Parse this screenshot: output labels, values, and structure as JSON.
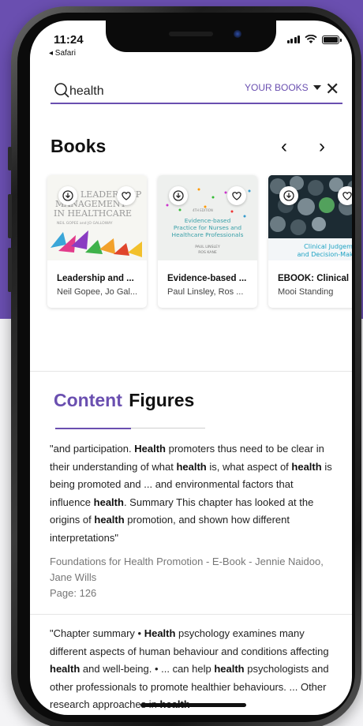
{
  "status": {
    "time": "11:24",
    "back_app": "◂ Safari"
  },
  "search": {
    "query": "health",
    "scope_label": "YOUR BOOKS",
    "close_label": "✕"
  },
  "books": {
    "heading": "Books",
    "prev": "‹",
    "next": "›",
    "items": [
      {
        "title": "Leadership and ...",
        "authors": "Neil Gopee, Jo Gal...",
        "cover_text": [
          "LEADERSHIP",
          "MANAGEMENT",
          "IN HEALTHCARE",
          "NEIL GOPEE and JO GALLOWAY"
        ]
      },
      {
        "title": "Evidence-based ...",
        "authors": "Paul Linsley, Ros ...",
        "cover_text": [
          "4TH EDITION",
          "Evidence-based",
          "Practice for Nurses and",
          "Healthcare Professionals",
          "PAUL LINSLEY",
          "ROS KANE"
        ]
      },
      {
        "title": "EBOOK: Clinical ...",
        "authors": "Mooi Standing",
        "cover_text": [
          "Clinical Judgement",
          "and Decision-Making"
        ]
      }
    ]
  },
  "content": {
    "heading_accent": "Content",
    "heading_rest": "Figures",
    "results": [
      {
        "segments": [
          {
            "t": "\"and participation. ",
            "b": false
          },
          {
            "t": "Health",
            "b": true
          },
          {
            "t": " promoters thus need to be clear in their understanding of what ",
            "b": false
          },
          {
            "t": "health",
            "b": true
          },
          {
            "t": " is, what aspect of ",
            "b": false
          },
          {
            "t": "health",
            "b": true
          },
          {
            "t": " is being promoted and ... and environmental factors that influence ",
            "b": false
          },
          {
            "t": "health",
            "b": true
          },
          {
            "t": ". Summary This chapter has looked at the origins of ",
            "b": false
          },
          {
            "t": "health",
            "b": true
          },
          {
            "t": " promotion, and shown how different interpretations\"",
            "b": false
          }
        ],
        "source": "Foundations for Health Promotion - E-Book - Jennie Naidoo, Jane Wills",
        "page": "Page: 126"
      },
      {
        "segments": [
          {
            "t": "\"Chapter summary • ",
            "b": false
          },
          {
            "t": "Health",
            "b": true
          },
          {
            "t": " psychology examines many different aspects of human behaviour and conditions affecting ",
            "b": false
          },
          {
            "t": "health",
            "b": true
          },
          {
            "t": " and well-being. • ... can help ",
            "b": false
          },
          {
            "t": "health",
            "b": true
          },
          {
            "t": " psychologists and other professionals to promote healthier behaviours. ... Other research approaches in ",
            "b": false
          },
          {
            "t": "health",
            "b": true
          }
        ]
      }
    ]
  },
  "colors": {
    "accent": "#6a4fb0",
    "background_top": "#6a4fb0"
  },
  "icons": [
    "search-icon",
    "chevron-down-icon",
    "close-icon",
    "chevron-left-icon",
    "chevron-right-icon",
    "download-icon",
    "heart-icon"
  ]
}
